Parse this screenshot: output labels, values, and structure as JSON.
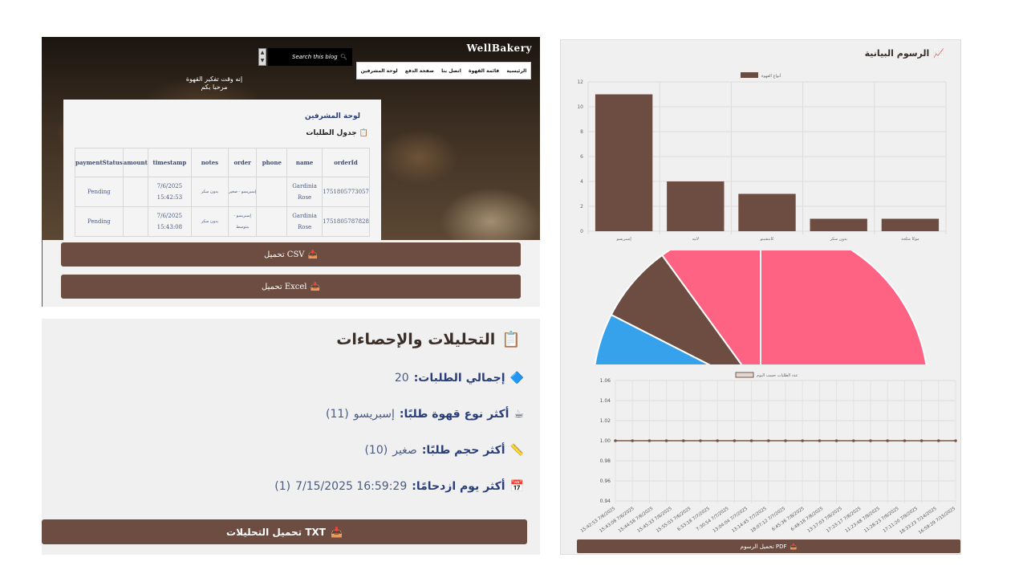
{
  "site": {
    "brand": "WellBakery",
    "search_placeholder": "Search this blog",
    "nav": [
      "الرئيسية",
      "قائمة القهوة",
      "اتصل بنا",
      "صفحة الدفع",
      "لوحة المشرفين"
    ],
    "welcome_line1": "إنه وقت تفكير القهوة",
    "welcome_line2": "مرحبا بكم"
  },
  "admin": {
    "title": "لوحة المشرفين",
    "subtitle": "جدول الطلبات",
    "columns": [
      "paymentStatus",
      "amount",
      "timestamp",
      "notes",
      "order",
      "phone",
      "name",
      "orderId"
    ],
    "rows": [
      {
        "paymentStatus": "Pending",
        "amount": "",
        "timestamp": "7/6/2025 15:42:53",
        "notes": "بدون سكر",
        "order": "إسبريسو - صغير",
        "phone": "",
        "name": "Gardinia Rose",
        "orderId": "1751805773057"
      },
      {
        "paymentStatus": "Pending",
        "amount": "",
        "timestamp": "7/6/2025 15:43:08",
        "notes": "بدون سكر",
        "order": "إسبريسو - متوسط",
        "phone": "",
        "name": "Gardinia Rose",
        "orderId": "1751805787828"
      }
    ],
    "csv_button": "تحميل CSV",
    "excel_button": "تحميل Excel"
  },
  "stats": {
    "title": "التحليلات والإحصاءات",
    "total_label": "إجمالي الطلبات:",
    "total_value": "20",
    "top_coffee_label": "أكثر نوع قهوة طلبًا:",
    "top_coffee_value": "إسبريسو",
    "top_coffee_count": "(11)",
    "top_size_label": "أكثر حجم طلبًا:",
    "top_size_value": "صغير",
    "top_size_count": "(10)",
    "busiest_label": "أكثر يوم ازدحامًا:",
    "busiest_value": "7/15/2025 16:59:29",
    "busiest_count": "(1)",
    "txt_button": "تحميل التحليلات TXT"
  },
  "charts": {
    "title": "الرسوم البيانية",
    "pdf_button": "تحميل الرسوم PDF",
    "colors": {
      "brown": "#6d4c41",
      "pink": "#ff6384",
      "blue": "#36a2eb",
      "line": "#7a5546"
    }
  },
  "chart_data": [
    {
      "type": "bar",
      "legend": "أنواع القهوة",
      "categories": [
        "إسبريسو",
        "لاتيه",
        "كابتشينو",
        "بدون سكر",
        "موكا مثلجة"
      ],
      "values": [
        11,
        4,
        3,
        1,
        1
      ],
      "ylim": [
        0,
        12
      ],
      "yticks": [
        0,
        2,
        4,
        6,
        8,
        10,
        12
      ],
      "grid": true,
      "legend_position": "top"
    },
    {
      "type": "pie",
      "half": true,
      "values": [
        10,
        4,
        3,
        3
      ],
      "colors": [
        "#ff6384",
        "#ff6384",
        "#6d4c41",
        "#36a2eb"
      ]
    },
    {
      "type": "line",
      "legend": "عدد الطلبات حسب اليوم",
      "x": [
        "15:42:53 7/6/2025",
        "15:43:08 7/6/2025",
        "15:44:58 7/6/2025",
        "15:45:33 7/6/2025",
        "15:55:03 7/6/2025",
        "6:53:18 7/7/2025",
        "7:30:54 7/7/2025",
        "13:04:04 7/7/2025",
        "13:14:45 7/7/2025",
        "18:07:12 7/7/2025",
        "6:45:36 7/8/2025",
        "6:49:18 7/8/2025",
        "13:17:03 7/8/2025",
        "17:23:17 7/8/2025",
        "11:23:48 7/9/2025",
        "11:28:23 7/9/2025",
        "17:11:20 7/9/2025",
        "18:33:23 7/14/2025",
        "16:59:29 7/15/2025"
      ],
      "values": [
        1,
        1,
        1,
        1,
        1,
        1,
        1,
        1,
        1,
        1,
        1,
        1,
        1,
        1,
        1,
        1,
        1,
        1,
        1,
        1,
        1
      ],
      "ylim": [
        0.94,
        1.06
      ],
      "yticks": [
        "0.94",
        "0.96",
        "0.98",
        "1.00",
        "1.02",
        "1.04",
        "1.06"
      ],
      "grid": true,
      "legend_position": "top"
    }
  ]
}
